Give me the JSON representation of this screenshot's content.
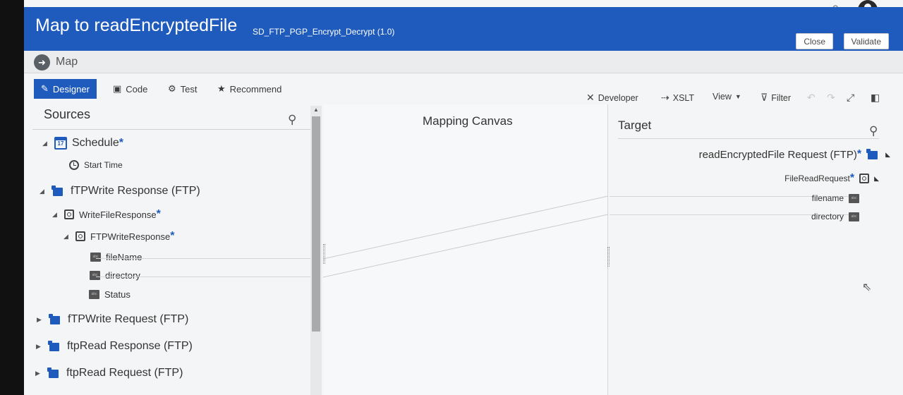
{
  "header": {
    "help_label": "?",
    "title": "Map to readEncryptedFile",
    "subtitle": "SD_FTP_PGP_Encrypt_Decrypt (1.0)",
    "close_label": "Close",
    "validate_label": "Validate",
    "accent_color": "#1f5bbd"
  },
  "subheader": {
    "label": "Map"
  },
  "tabs": [
    {
      "label": "Designer",
      "icon": "designer-icon",
      "active": true
    },
    {
      "label": "Code",
      "icon": "code-icon"
    },
    {
      "label": "Test",
      "icon": "gear-icon"
    },
    {
      "label": "Recommend",
      "icon": "star-icon"
    }
  ],
  "toolbar": {
    "developer_label": "Developer",
    "xslt_label": "XSLT",
    "view_label": "View",
    "filter_label": "Filter"
  },
  "sources": {
    "title": "Sources",
    "nodes": [
      {
        "label": "Schedule",
        "required": "*"
      },
      {
        "label": "Start Time"
      },
      {
        "label": "fTPWrite Response (FTP)"
      },
      {
        "label": "WriteFileResponse",
        "required": "*"
      },
      {
        "label": "FTPWriteResponse",
        "required": "*"
      },
      {
        "label": "fileName"
      },
      {
        "label": "directory"
      },
      {
        "label": "Status"
      },
      {
        "label": "fTPWrite Request (FTP)"
      },
      {
        "label": "ftpRead Response (FTP)"
      },
      {
        "label": "ftpRead Request (FTP)"
      }
    ]
  },
  "canvas": {
    "title": "Mapping Canvas"
  },
  "target": {
    "title": "Target",
    "nodes": [
      {
        "label": "readEncryptedFile Request (FTP)",
        "required": "*"
      },
      {
        "label": "FileReadRequest",
        "required": "*"
      },
      {
        "label": "filename"
      },
      {
        "label": "directory"
      }
    ]
  }
}
